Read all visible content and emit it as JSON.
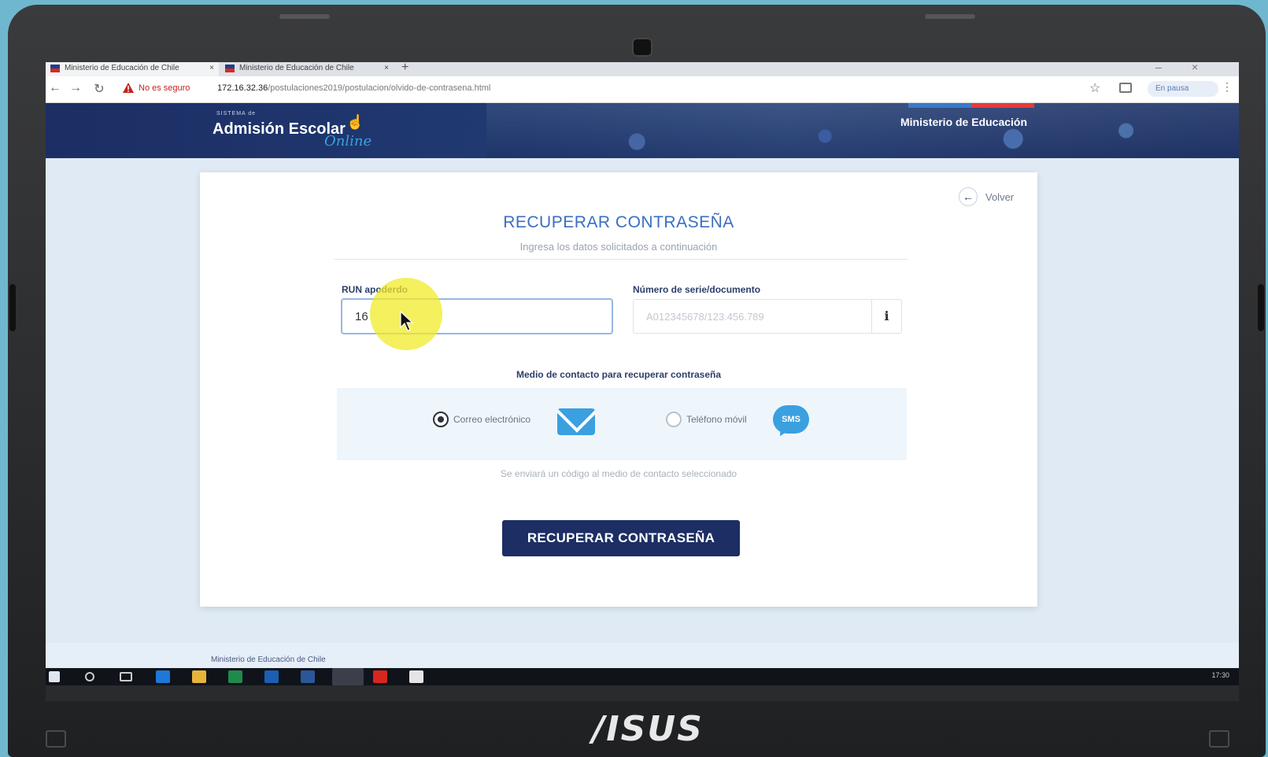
{
  "browser": {
    "tabs": [
      {
        "label": "Ministerio de Educación de Chile"
      },
      {
        "label": "Ministerio de Educación de Chile"
      }
    ],
    "new_tab": "+",
    "security_warning": "No es seguro",
    "url_host": "172.16.32.36",
    "url_path": "/postulaciones2019/postulacion/olvido-de-contrasena.html",
    "profile_status": "En pausa"
  },
  "header": {
    "brand_top": "SISTEMA de",
    "brand": "Admisión Escolar",
    "brand_sub": "Online",
    "ministry": "Ministerio de Educación"
  },
  "card": {
    "back_label": "Volver",
    "title": "RECUPERAR CONTRASEÑA",
    "subtitle": "Ingresa los datos solicitados a continuación",
    "run_label": "RUN apoderdo",
    "run_value": "16",
    "doc_label": "Número de serie/documento",
    "doc_placeholder": "A012345678/123.456.789",
    "info_glyph": "i",
    "contact_label": "Medio de contacto para recuperar contraseña",
    "options": [
      {
        "label": "Correo electrónico",
        "selected": true
      },
      {
        "label": "Teléfono móvil",
        "selected": false
      }
    ],
    "sms_text": "SMS",
    "contact_note": "Se enviará un código al medio de contacto seleccionado",
    "submit_label": "RECUPERAR CONTRASEÑA"
  },
  "footer": {
    "text": "Ministerio de Educación de Chile"
  },
  "taskbar": {
    "time": "17:30"
  },
  "device": {
    "logo": "/ISUS"
  },
  "colors": {
    "accent": "#1c2e64",
    "title": "#3a6ec1",
    "icon_blue": "#3aa0e0",
    "highlight": "#f0eb28"
  }
}
